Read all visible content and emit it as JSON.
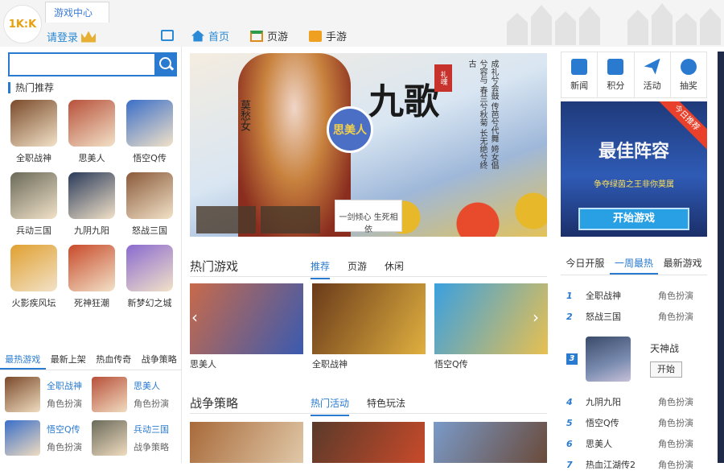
{
  "header": {
    "logo_text": "1K:K",
    "tab_label": "游戏中心",
    "login_label": "请登录",
    "nav": [
      {
        "label": "首页",
        "icon": "home-icon"
      },
      {
        "label": "页游",
        "icon": "webgame-icon"
      },
      {
        "label": "手游",
        "icon": "mobile-game-icon"
      }
    ]
  },
  "sidebar": {
    "search": {
      "value": "",
      "placeholder": ""
    },
    "hot_title": "热门推荐",
    "hot_games": [
      {
        "name": "全职战神",
        "color": "#7a4a2a"
      },
      {
        "name": "思美人",
        "color": "#b8503a"
      },
      {
        "name": "悟空Q传",
        "color": "#3a6ec8"
      },
      {
        "name": "兵动三国",
        "color": "#6a6a5a"
      },
      {
        "name": "九阴九阳",
        "color": "#2a3a5a"
      },
      {
        "name": "怒战三国",
        "color": "#8a5a3a"
      },
      {
        "name": "火影疾风坛",
        "color": "#e0a030"
      },
      {
        "name": "死神狂潮",
        "color": "#c84a2a"
      },
      {
        "name": "新梦幻之城",
        "color": "#8a6ad0"
      }
    ],
    "tabs": [
      {
        "label": "最热游戏",
        "active": true
      },
      {
        "label": "最新上架",
        "active": false
      },
      {
        "label": "热血传奇",
        "active": false
      },
      {
        "label": "战争策略",
        "active": false
      }
    ],
    "list": [
      {
        "name": "全职战神",
        "category": "角色扮演",
        "color": "#7a4a2a"
      },
      {
        "name": "思美人",
        "category": "角色扮演",
        "color": "#b8503a"
      },
      {
        "name": "悟空Q传",
        "category": "角色扮演",
        "color": "#3a6ec8"
      },
      {
        "name": "兵动三国",
        "category": "战争策略",
        "color": "#6a6a5a"
      }
    ]
  },
  "banner": {
    "title": "九歌",
    "tag": "礼魂",
    "logo": "思美人",
    "name": "莫愁女",
    "slogan": "一剑倾心 生死相依",
    "poem": "成礼兮会鼓 传芭兮代舞 姱女倡兮容与 春兰兮秋菊 长无绝兮终古"
  },
  "hot_section": {
    "title": "热门游戏",
    "tabs": [
      {
        "label": "推荐",
        "active": true
      },
      {
        "label": "页游",
        "active": false
      },
      {
        "label": "休闲",
        "active": false
      }
    ],
    "games": [
      {
        "name": "思美人",
        "color1": "#c86a4a",
        "color2": "#3a5ab0"
      },
      {
        "name": "全职战神",
        "color1": "#6a3a1a",
        "color2": "#e0b040"
      },
      {
        "name": "悟空Q传",
        "color1": "#3aa0e0",
        "color2": "#e8c050"
      }
    ]
  },
  "war_section": {
    "title": "战争策略",
    "tabs": [
      {
        "label": "热门活动",
        "active": true
      },
      {
        "label": "特色玩法",
        "active": false
      }
    ],
    "games": [
      {
        "color1": "#a86a3a",
        "color2": "#e0c8a8"
      },
      {
        "color1": "#5a3a2a",
        "color2": "#c84a2a"
      },
      {
        "color1": "#7a9ac8",
        "color2": "#6a4a3a"
      }
    ]
  },
  "quick_links": [
    {
      "label": "新闻",
      "icon": "news-icon"
    },
    {
      "label": "积分",
      "icon": "points-icon"
    },
    {
      "label": "活动",
      "icon": "activity-icon"
    },
    {
      "label": "抽奖",
      "icon": "lottery-icon"
    }
  ],
  "promo": {
    "ribbon": "今日推荐",
    "title": "最佳阵容",
    "sub": "争夺绿茵之王非你莫属",
    "button": "开始游戏"
  },
  "rank": {
    "tabs": [
      {
        "label": "今日开服",
        "active": false
      },
      {
        "label": "一周最热",
        "active": true
      },
      {
        "label": "最新游戏",
        "active": false
      }
    ],
    "items_top": [
      {
        "num": "1",
        "name": "全职战神",
        "category": "角色扮演"
      },
      {
        "num": "2",
        "name": "怒战三国",
        "category": "角色扮演"
      }
    ],
    "feature": {
      "num": "3",
      "name": "天神战",
      "button": "开始"
    },
    "items_bottom": [
      {
        "num": "4",
        "name": "九阴九阳",
        "category": "角色扮演"
      },
      {
        "num": "5",
        "name": "悟空Q传",
        "category": "角色扮演"
      },
      {
        "num": "6",
        "name": "思美人",
        "category": "角色扮演"
      },
      {
        "num": "7",
        "name": "热血江湖传2",
        "category": "角色扮演"
      }
    ]
  }
}
